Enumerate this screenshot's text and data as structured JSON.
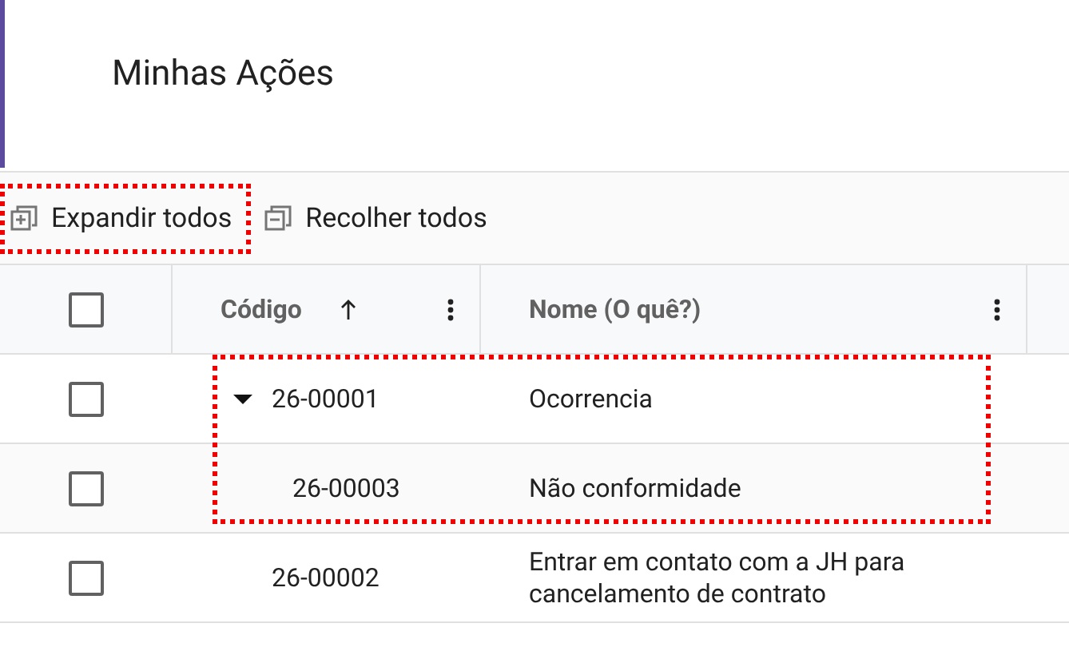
{
  "page": {
    "title": "Minhas Ações"
  },
  "toolbar": [
    {
      "kind": "expand",
      "label": "Expandir todos",
      "highlighted": true
    },
    {
      "kind": "collapse",
      "label": "Recolher todos",
      "highlighted": false
    }
  ],
  "table": {
    "select_all": {
      "checked": false
    },
    "columns": [
      {
        "label": "Código",
        "sorted": true
      },
      {
        "label": "Nome (O quê?)",
        "sorted": false
      }
    ],
    "rows": [
      {
        "code": "26-00001",
        "name": "Ocorrencia",
        "checked": false,
        "expanded": true,
        "highlighted": true,
        "children": [
          {
            "code": "26-00003",
            "name": "Não conformidade",
            "checked": false,
            "highlighted": true
          }
        ]
      },
      {
        "code": "26-00002",
        "name": "Entrar em contato com a JH para cancelamento de contrato",
        "checked": false,
        "highlighted": false
      }
    ]
  }
}
